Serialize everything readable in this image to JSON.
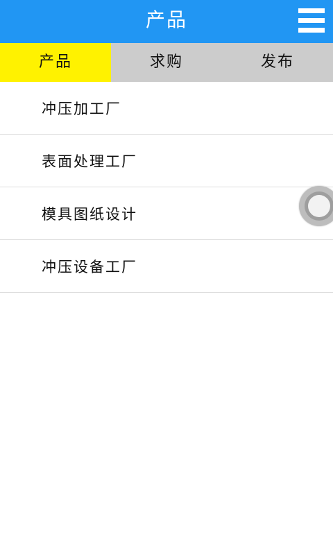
{
  "header": {
    "title": "产品",
    "menu_icon": "menu-icon"
  },
  "tabs": [
    {
      "label": "产品",
      "active": true
    },
    {
      "label": "求购",
      "active": false
    },
    {
      "label": "发布",
      "active": false
    }
  ],
  "list": {
    "items": [
      {
        "label": "冲压加工厂"
      },
      {
        "label": "表面处理工厂"
      },
      {
        "label": "模具图纸设计"
      },
      {
        "label": "冲压设备工厂"
      }
    ]
  },
  "floating_button": {
    "icon": "assistive-touch-icon"
  },
  "colors": {
    "header_bg": "#2196f3",
    "tab_active_bg": "#fff200",
    "tab_bg": "#cccccc"
  }
}
